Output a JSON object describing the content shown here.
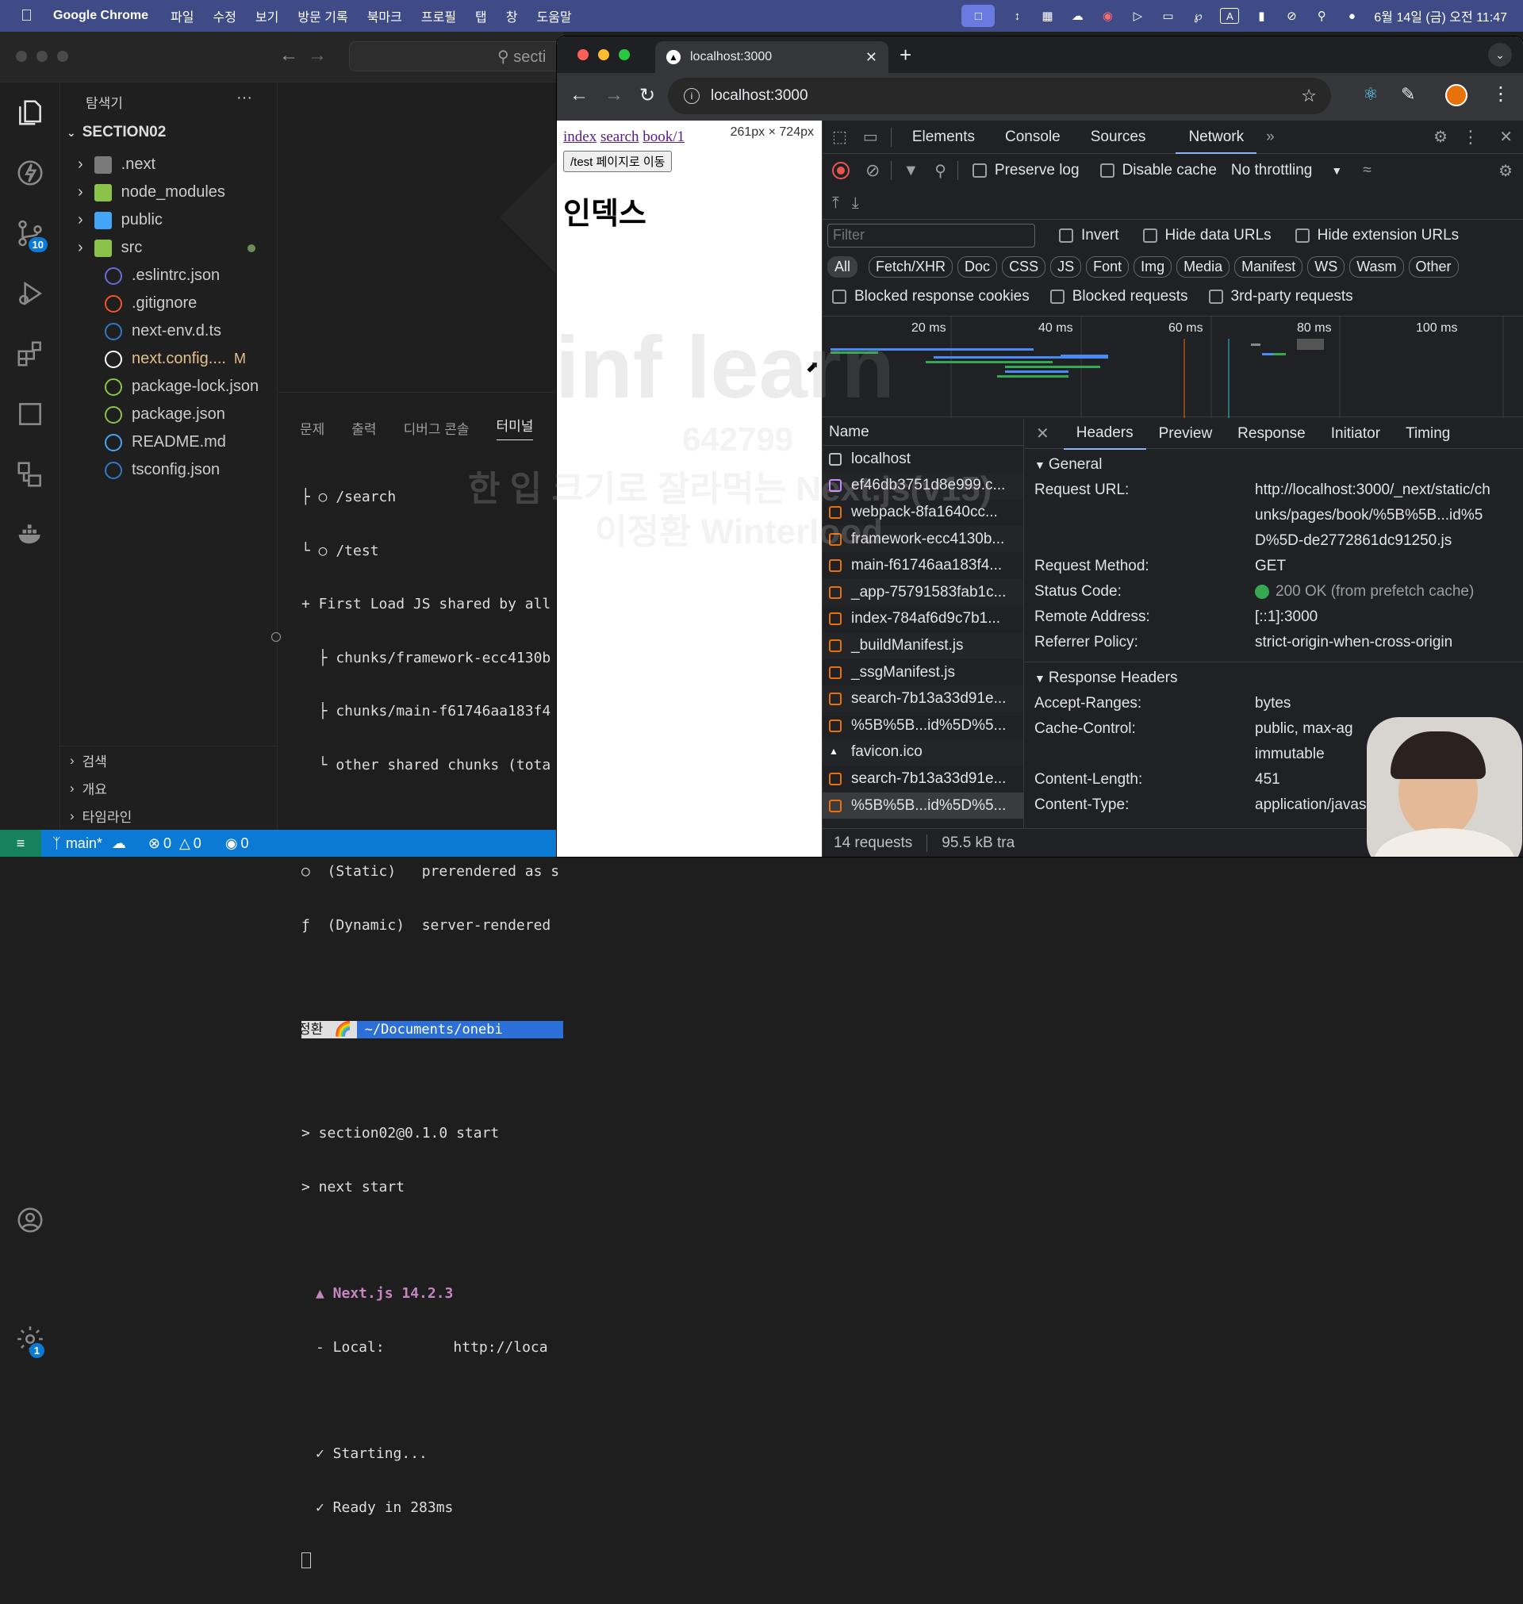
{
  "menubar": {
    "app": "Google Chrome",
    "items": [
      "파일",
      "수정",
      "보기",
      "방문 기록",
      "북마크",
      "프로필",
      "탭",
      "창",
      "도움말"
    ],
    "datetime": "6월 14일 (금) 오전 11:47",
    "input_source": "A"
  },
  "vscode": {
    "search_placeholder": "secti",
    "explorer_title": "탐색기",
    "explorer_more": "···",
    "root_folder": "SECTION02",
    "source_control_badge": "10",
    "settings_badge": "1",
    "tree": [
      {
        "name": ".next",
        "type": "folder",
        "color": "#7a7a7a"
      },
      {
        "name": "node_modules",
        "type": "folder",
        "color": "#8bc34a"
      },
      {
        "name": "public",
        "type": "folder",
        "color": "#42a5f5"
      },
      {
        "name": "src",
        "type": "folder",
        "color": "#8bc34a"
      },
      {
        "name": ".eslintrc.json",
        "type": "file",
        "icon": "eslint",
        "color": "#6b6bd9"
      },
      {
        "name": ".gitignore",
        "type": "file",
        "icon": "git",
        "color": "#f0552e"
      },
      {
        "name": "next-env.d.ts",
        "type": "file",
        "icon": "ts",
        "color": "#3178c6"
      },
      {
        "name": "next.config....",
        "type": "file",
        "icon": "next",
        "color": "#ffffff",
        "status": "M"
      },
      {
        "name": "package-lock.json",
        "type": "file",
        "icon": "npm",
        "color": "#8bc34a"
      },
      {
        "name": "package.json",
        "type": "file",
        "icon": "npm",
        "color": "#8bc34a"
      },
      {
        "name": "README.md",
        "type": "file",
        "icon": "info",
        "color": "#42a5f5"
      },
      {
        "name": "tsconfig.json",
        "type": "file",
        "icon": "ts",
        "color": "#3178c6"
      }
    ],
    "bottom_sections": [
      "검색",
      "개요",
      "타임라인"
    ],
    "panel_tabs": [
      "문제",
      "출력",
      "디버그 콘솔",
      "터미널"
    ],
    "terminal": {
      "route_lines": [
        "├ ○ /search",
        "└ ○ /test",
        "+ First Load JS shared by all",
        "  ├ chunks/framework-ecc4130b",
        "  ├ chunks/main-f61746aa183f4",
        "  └ other shared chunks (tota"
      ],
      "legend_lines": [
        "○  (Static)   prerendered as s",
        "ƒ  (Dynamic)  server-rendered"
      ],
      "prompt_user": "정환",
      "prompt_path": "~/Documents/onebi",
      "cmd_lines": [
        "> section02@0.1.0 start",
        "> next start"
      ],
      "next_version": "▲ Next.js 14.2.3",
      "local_line": "- Local:        http://loca",
      "status_lines": [
        "✓ Starting...",
        "✓ Ready in 283ms"
      ]
    },
    "statusbar": {
      "branch": "main*",
      "errors": "0",
      "warnings": "0",
      "ports": "0"
    }
  },
  "chrome": {
    "tab_title": "localhost:3000",
    "url": "localhost:3000",
    "page": {
      "links": [
        "index",
        "search",
        "book/1"
      ],
      "button": "/test 페이지로 이동",
      "heading": "인덱스",
      "size_tooltip": "261px × 724px"
    },
    "devtools": {
      "tabs": [
        "Elements",
        "Console",
        "Sources",
        "Network"
      ],
      "active_tab": "Network",
      "preserve_log": "Preserve log",
      "disable_cache": "Disable cache",
      "throttling": "No throttling",
      "filter_placeholder": "Filter",
      "invert": "Invert",
      "hide_data_urls": "Hide data URLs",
      "hide_extension_urls": "Hide extension URLs",
      "type_filters": [
        "All",
        "Fetch/XHR",
        "Doc",
        "CSS",
        "JS",
        "Font",
        "Img",
        "Media",
        "Manifest",
        "WS",
        "Wasm",
        "Other"
      ],
      "blocked_response_cookies": "Blocked response cookies",
      "blocked_requests": "Blocked requests",
      "third_party": "3rd-party requests",
      "timeline_ticks": [
        "20 ms",
        "40 ms",
        "60 ms",
        "80 ms",
        "100 ms"
      ],
      "name_header": "Name",
      "requests": [
        {
          "name": "localhost",
          "icon": "doc"
        },
        {
          "name": "ef46db3751d8e999.c...",
          "icon": "css"
        },
        {
          "name": "webpack-8fa1640cc...",
          "icon": "js"
        },
        {
          "name": "framework-ecc4130b...",
          "icon": "js"
        },
        {
          "name": "main-f61746aa183f4...",
          "icon": "js"
        },
        {
          "name": "_app-75791583fab1c...",
          "icon": "js"
        },
        {
          "name": "index-784af6d9c7b1...",
          "icon": "js"
        },
        {
          "name": "_buildManifest.js",
          "icon": "js"
        },
        {
          "name": "_ssgManifest.js",
          "icon": "js"
        },
        {
          "name": "search-7b13a33d91e...",
          "icon": "js"
        },
        {
          "name": "%5B%5B...id%5D%5...",
          "icon": "js"
        },
        {
          "name": "favicon.ico",
          "icon": "img"
        },
        {
          "name": "search-7b13a33d91e...",
          "icon": "js"
        },
        {
          "name": "%5B%5B...id%5D%5...",
          "icon": "js"
        }
      ],
      "summary_requests": "14 requests",
      "summary_transfer": "95.5 kB tra",
      "detail_tabs": [
        "Headers",
        "Preview",
        "Response",
        "Initiator",
        "Timing"
      ],
      "general_title": "General",
      "request_url_label": "Request URL:",
      "request_url_lines": [
        "http://localhost:3000/_next/static/ch",
        "unks/pages/book/%5B%5B...id%5",
        "D%5D-de2772861dc91250.js"
      ],
      "method_label": "Request Method:",
      "method": "GET",
      "status_label": "Status Code:",
      "status": "200 OK (from prefetch cache)",
      "remote_label": "Remote Address:",
      "remote": "[::1]:3000",
      "referrer_label": "Referrer Policy:",
      "referrer": "strict-origin-when-cross-origin",
      "response_headers_title": "Response Headers",
      "resp": [
        {
          "k": "Accept-Ranges:",
          "v": "bytes"
        },
        {
          "k": "Cache-Control:",
          "v": "public, max-ag"
        },
        {
          "k": "",
          "v": "immutable"
        },
        {
          "k": "Content-Length:",
          "v": "451"
        },
        {
          "k": "Content-Type:",
          "v": "application/javascrip"
        }
      ]
    }
  },
  "watermark": {
    "logo": "inf learn",
    "id": "642799",
    "line1": "한 입 크기로 잘라먹는 Next.js(v15)",
    "line2": "이정환 Winterlood"
  },
  "colors": {
    "menubar": "#3e4b86",
    "statusbar": "#0b7ad4",
    "accent_blue": "#8ab4f8",
    "record_red": "#e8554e",
    "ok_green": "#34a853"
  }
}
